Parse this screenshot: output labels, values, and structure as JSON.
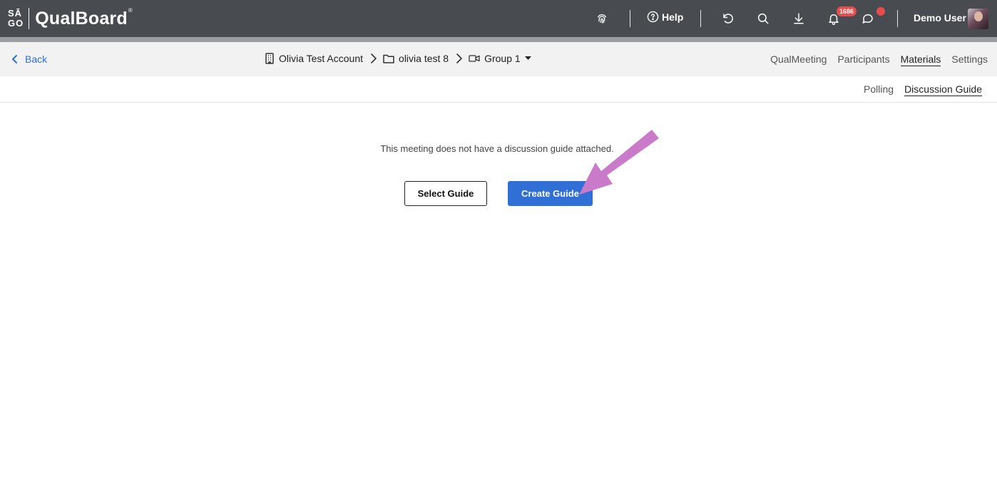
{
  "app": {
    "logo_top": "SĀ",
    "logo_bottom": "GO",
    "name": "QualBoard",
    "reg_mark": "®"
  },
  "topbar": {
    "help_label": "Help",
    "notifications_count": "1686",
    "user_name": "Demo User",
    "icons": [
      "fingerprint-icon",
      "help-icon",
      "undo-icon",
      "search-icon",
      "download-icon",
      "bell-icon",
      "chat-icon"
    ]
  },
  "subnav": {
    "back_label": "Back",
    "breadcrumbs": [
      {
        "label": "Olivia Test Account",
        "icon": "building-icon"
      },
      {
        "label": "olivia test 8",
        "icon": "folder-icon"
      },
      {
        "label": "Group 1",
        "icon": "video-icon"
      }
    ],
    "nav": [
      "QualMeeting",
      "Participants",
      "Materials",
      "Settings"
    ],
    "active_nav": "Materials"
  },
  "materials_tabs": {
    "items": [
      "Polling",
      "Discussion Guide"
    ],
    "active": "Discussion Guide"
  },
  "main": {
    "message": "This meeting does not have a discussion guide attached.",
    "select_button": "Select Guide",
    "create_button": "Create Guide"
  },
  "colors": {
    "topbar": "#484b4f",
    "accent": "#2f6fd6",
    "badge": "#e74c4c",
    "annotation_arrow": "#c97ac9"
  }
}
